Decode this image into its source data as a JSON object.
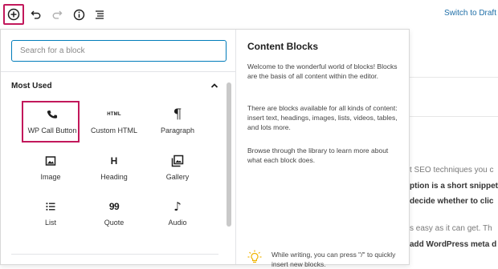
{
  "toolbar": {
    "add_icon": "plus-circle-icon",
    "undo_icon": "undo-icon",
    "redo_icon": "redo-icon",
    "info_icon": "info-icon",
    "outline_icon": "list-outline-icon",
    "switch_to_draft": "Switch to Draft"
  },
  "inserter": {
    "search": {
      "placeholder": "Search for a block",
      "value": ""
    },
    "panel": {
      "title": "Most Used",
      "chevron_icon": "chevron-up-icon"
    },
    "blocks": [
      {
        "label": "WP Call Button",
        "icon": "phone-icon"
      },
      {
        "label": "Custom HTML",
        "icon": "html-icon",
        "icon_text": "HTML"
      },
      {
        "label": "Paragraph",
        "icon": "paragraph-icon",
        "icon_text": "¶"
      },
      {
        "label": "Image",
        "icon": "image-icon"
      },
      {
        "label": "Heading",
        "icon": "heading-icon",
        "icon_text": "H"
      },
      {
        "label": "Gallery",
        "icon": "gallery-icon"
      },
      {
        "label": "List",
        "icon": "list-icon"
      },
      {
        "label": "Quote",
        "icon": "quote-icon",
        "icon_text": "99"
      },
      {
        "label": "Audio",
        "icon": "audio-icon",
        "icon_text": "♪"
      }
    ]
  },
  "help": {
    "title": "Content Blocks",
    "p1": "Welcome to the wonderful world of blocks! Blocks are the basis of all content within the editor.",
    "p2": "There are blocks available for all kinds of content: insert text, headings, images, lists, videos, tables, and lots more.",
    "p3": "Browse through the library to learn more about what each block does.",
    "tip": "While writing, you can press \"/\" to quickly insert new blocks.",
    "tip_icon": "lightbulb-icon"
  },
  "editor_background": {
    "line1": "t SEO techniques you c",
    "line2": "ption is a short snippet,",
    "line3": "decide whether to clic",
    "line4": "s easy as it can get. Th",
    "line5": "add WordPress meta d"
  },
  "colors": {
    "highlight": "#c2185b",
    "accent": "#007cba",
    "link": "#1e6ea7"
  }
}
